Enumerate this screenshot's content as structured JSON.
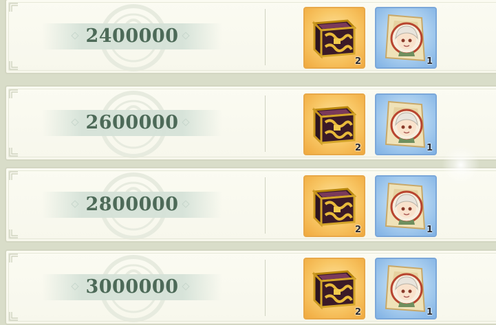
{
  "rewards": [
    {
      "score": "2400000",
      "items": [
        {
          "name": "chest-icon",
          "qty": "2"
        },
        {
          "name": "character-card-icon",
          "qty": "1"
        }
      ]
    },
    {
      "score": "2600000",
      "items": [
        {
          "name": "chest-icon",
          "qty": "2"
        },
        {
          "name": "character-card-icon",
          "qty": "1"
        }
      ]
    },
    {
      "score": "2800000",
      "items": [
        {
          "name": "chest-icon",
          "qty": "2"
        },
        {
          "name": "character-card-icon",
          "qty": "1"
        }
      ]
    },
    {
      "score": "3000000",
      "items": [
        {
          "name": "chest-icon",
          "qty": "2"
        },
        {
          "name": "character-card-icon",
          "qty": "1"
        }
      ]
    }
  ],
  "colors": {
    "score_text": "#4d6a58",
    "chest_bg": "#f8c664",
    "card_bg": "#a8cdee"
  }
}
